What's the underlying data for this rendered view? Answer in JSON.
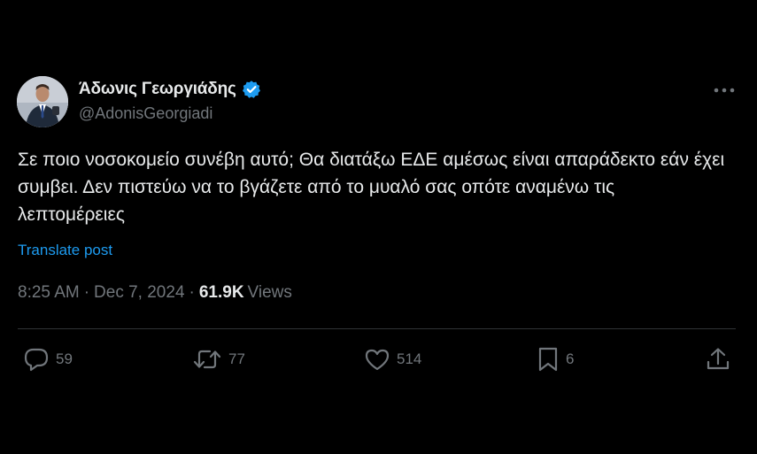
{
  "author": {
    "display_name": "Άδωνις Γεωργιάδης",
    "handle": "@AdonisGeorgiadi",
    "verified": true,
    "avatar_icon": "profile-photo"
  },
  "tweet": {
    "text": "Σε ποιο νοσοκομείο συνέβη αυτό; Θα διατάξω ΕΔΕ αμέσως είναι απαράδεκτο εάν έχει συμβει. Δεν πιστεύω να το βγάζετε από το μυαλό σας οπότε αναμένω τις λεπτομέρειες",
    "translate_label": "Translate post",
    "time": "8:25 AM",
    "date": "Dec 7, 2024",
    "views_count": "61.9K",
    "views_label": "Views",
    "separator": "·"
  },
  "actions": {
    "replies": "59",
    "reposts": "77",
    "likes": "514",
    "bookmarks": "6"
  },
  "colors": {
    "background": "#000000",
    "text": "#e7e9ea",
    "secondary": "#71767b",
    "accent": "#1d9bf0",
    "divider": "#2f3336"
  }
}
